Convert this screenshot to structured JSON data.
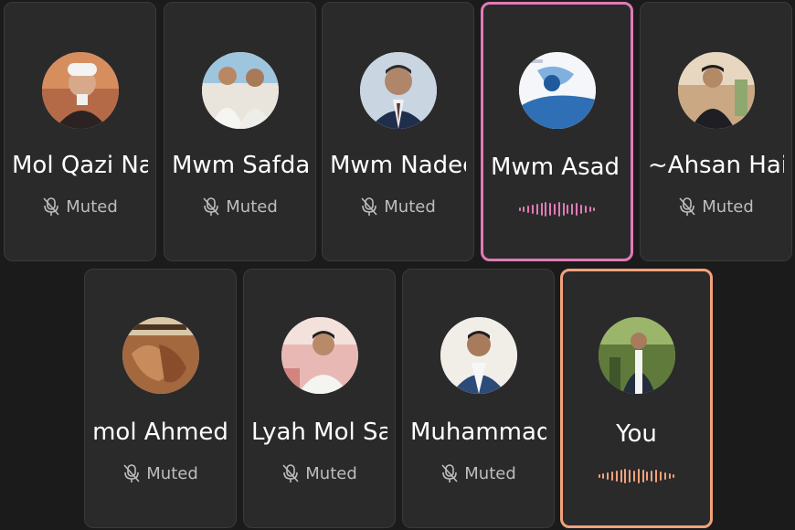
{
  "participants": [
    {
      "name": "Mol Qazi Na",
      "status": "Muted",
      "speaking": false,
      "avatar": "cleric-white-turban-photo"
    },
    {
      "name": "Mwm Safdar",
      "status": "Muted",
      "speaking": false,
      "avatar": "two-men-white-clothes-photo"
    },
    {
      "name": "Mwm Nadee",
      "status": "Muted",
      "speaking": false,
      "avatar": "man-suit-portrait-photo"
    },
    {
      "name": "Mwm Asad I",
      "status": "",
      "speaking": true,
      "avatar": "blue-graphic-photo",
      "accent": "#e07bb6"
    },
    {
      "name": "~Ahsan Haid",
      "status": "Muted",
      "speaking": false,
      "avatar": "man-dark-shirt-outdoor-photo"
    },
    {
      "name": "mol Ahmed",
      "status": "Muted",
      "speaking": false,
      "avatar": "textured-red-brown-photo"
    },
    {
      "name": "Lyah Mol Saj",
      "status": "Muted",
      "speaking": false,
      "avatar": "man-white-shirt-photo"
    },
    {
      "name": "Muhammad",
      "status": "Muted",
      "speaking": false,
      "avatar": "man-vest-portrait-photo"
    },
    {
      "name": "You",
      "status": "",
      "speaking": true,
      "avatar": "man-standing-outdoor-photo",
      "accent": "#f2a27b"
    }
  ],
  "icons": {
    "muted": "mic-off-icon",
    "speaking": "audio-waveform-icon"
  },
  "colors": {
    "background": "#1b1b1c",
    "tile": "#2a2a2b",
    "speaking_pink": "#e07bb6",
    "speaking_orange": "#f2a27b"
  }
}
